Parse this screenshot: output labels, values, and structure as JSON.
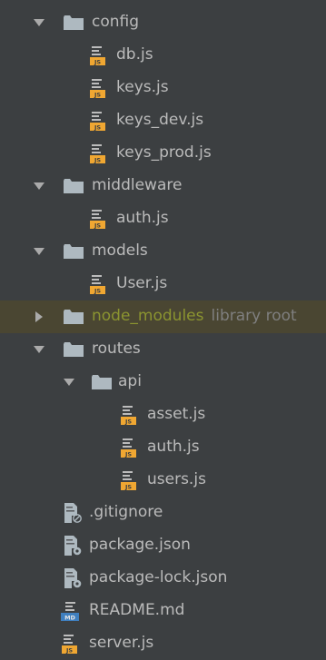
{
  "tree": {
    "items": [
      {
        "label": "config",
        "type": "folder",
        "expanded": true,
        "depth": 0
      },
      {
        "label": "db.js",
        "type": "js",
        "depth": 1
      },
      {
        "label": "keys.js",
        "type": "js",
        "depth": 1
      },
      {
        "label": "keys_dev.js",
        "type": "js",
        "depth": 1
      },
      {
        "label": "keys_prod.js",
        "type": "js",
        "depth": 1
      },
      {
        "label": "middleware",
        "type": "folder",
        "expanded": true,
        "depth": 0
      },
      {
        "label": "auth.js",
        "type": "js",
        "depth": 1
      },
      {
        "label": "models",
        "type": "folder",
        "expanded": true,
        "depth": 0
      },
      {
        "label": "User.js",
        "type": "js",
        "depth": 1
      },
      {
        "label": "node_modules",
        "sublabel": "library root",
        "type": "folder",
        "expanded": false,
        "depth": 0,
        "excluded": true
      },
      {
        "label": "routes",
        "type": "folder",
        "expanded": true,
        "depth": 0
      },
      {
        "label": "api",
        "type": "folder",
        "expanded": true,
        "depth": 1
      },
      {
        "label": "asset.js",
        "type": "js",
        "depth": 2
      },
      {
        "label": "auth.js",
        "type": "js",
        "depth": 2
      },
      {
        "label": "users.js",
        "type": "js",
        "depth": 2
      },
      {
        "label": ".gitignore",
        "type": "gitignore",
        "depth": 0
      },
      {
        "label": "package.json",
        "type": "json",
        "depth": 0
      },
      {
        "label": "package-lock.json",
        "type": "json",
        "depth": 0
      },
      {
        "label": "README.md",
        "type": "md",
        "depth": 0
      },
      {
        "label": "server.js",
        "type": "js",
        "depth": 0
      }
    ]
  },
  "colors": {
    "background": "#3c3f41",
    "text": "#bbbbbb",
    "excluded_row": "#4a4632",
    "excluded_text": "#8b9430",
    "library_root_text": "#7f7f7f",
    "folder": "#aeb9c0",
    "js_badge": "#f0a732"
  },
  "icons": {
    "folder": "folder-icon",
    "expanded": "chevron-down-icon",
    "collapsed": "chevron-right-icon",
    "js": "js-file-icon",
    "json": "json-file-icon",
    "md": "markdown-file-icon",
    "gitignore": "gitignore-file-icon"
  }
}
